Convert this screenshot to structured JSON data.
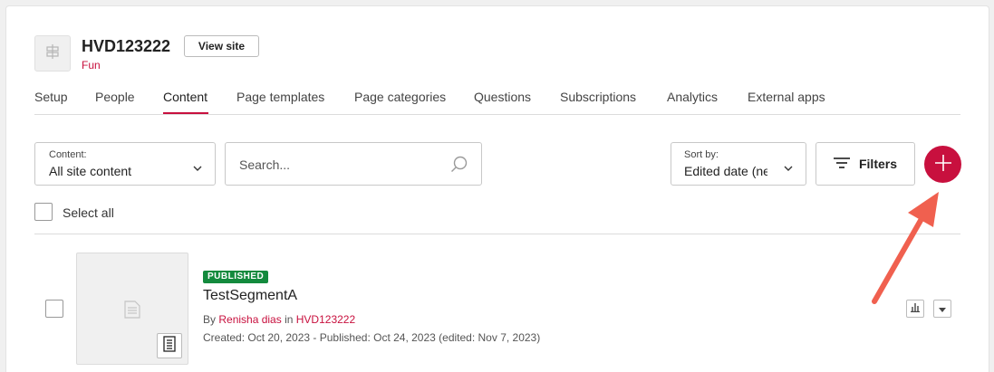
{
  "site": {
    "title": "HVD123222",
    "subtitle": "Fun",
    "view_site_label": "View site"
  },
  "tabs": [
    {
      "label": "Setup"
    },
    {
      "label": "People"
    },
    {
      "label": "Content",
      "active": true
    },
    {
      "label": "Page templates"
    },
    {
      "label": "Page categories"
    },
    {
      "label": "Questions"
    },
    {
      "label": "Subscriptions"
    },
    {
      "label": "Analytics"
    },
    {
      "label": "External apps"
    }
  ],
  "toolbar": {
    "content_label": "Content:",
    "content_value": "All site content",
    "search_placeholder": "Search...",
    "sort_label": "Sort by:",
    "sort_value": "Edited date (newest)",
    "filters_label": "Filters",
    "add_icon": "plus-icon",
    "select_all_label": "Select all"
  },
  "items": [
    {
      "status": "PUBLISHED",
      "title": "TestSegmentA",
      "by_prefix": "By",
      "author": "Renisha dias",
      "in_word": "in",
      "site": "HVD123222",
      "dates": "Created: Oct 20, 2023 - Published: Oct 24, 2023 (edited: Nov 7, 2023)"
    }
  ],
  "colors": {
    "accent": "#c8103e",
    "published": "#138a3d",
    "annotation_arrow": "#f0604f"
  }
}
